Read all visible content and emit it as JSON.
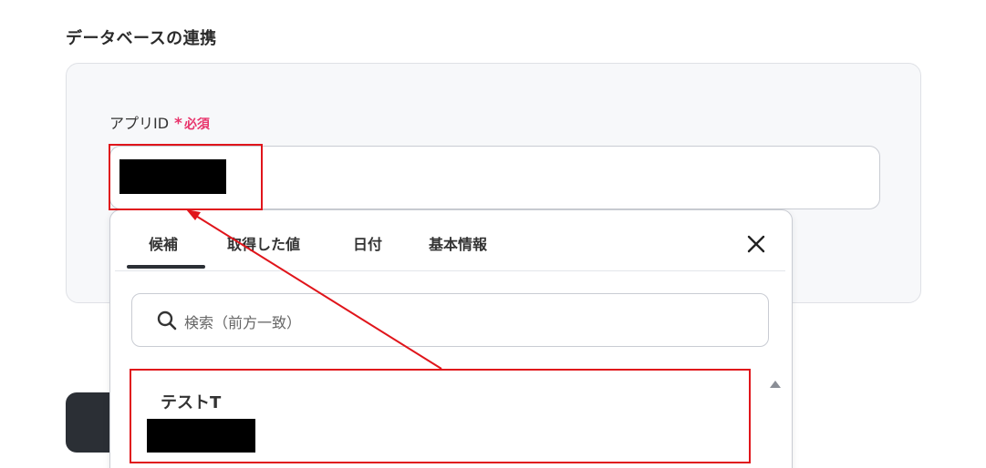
{
  "section": {
    "title": "データベースの連携"
  },
  "field": {
    "label": "アプリID",
    "asterisk": "*",
    "required": "必須"
  },
  "dropdown": {
    "tabs": [
      {
        "label": "候補",
        "active": true
      },
      {
        "label": "取得した値",
        "active": false
      },
      {
        "label": "日付",
        "active": false
      },
      {
        "label": "基本情報",
        "active": false
      }
    ],
    "search_placeholder": "検索（前方一致）",
    "candidates": [
      {
        "name": "テストT"
      }
    ]
  },
  "colors": {
    "required_pink": "#e8336b",
    "highlight_red": "#e0151b",
    "dark_button": "#2b2f35"
  },
  "icons": [
    "close-icon",
    "search-icon",
    "scroll-up-arrow-icon"
  ]
}
